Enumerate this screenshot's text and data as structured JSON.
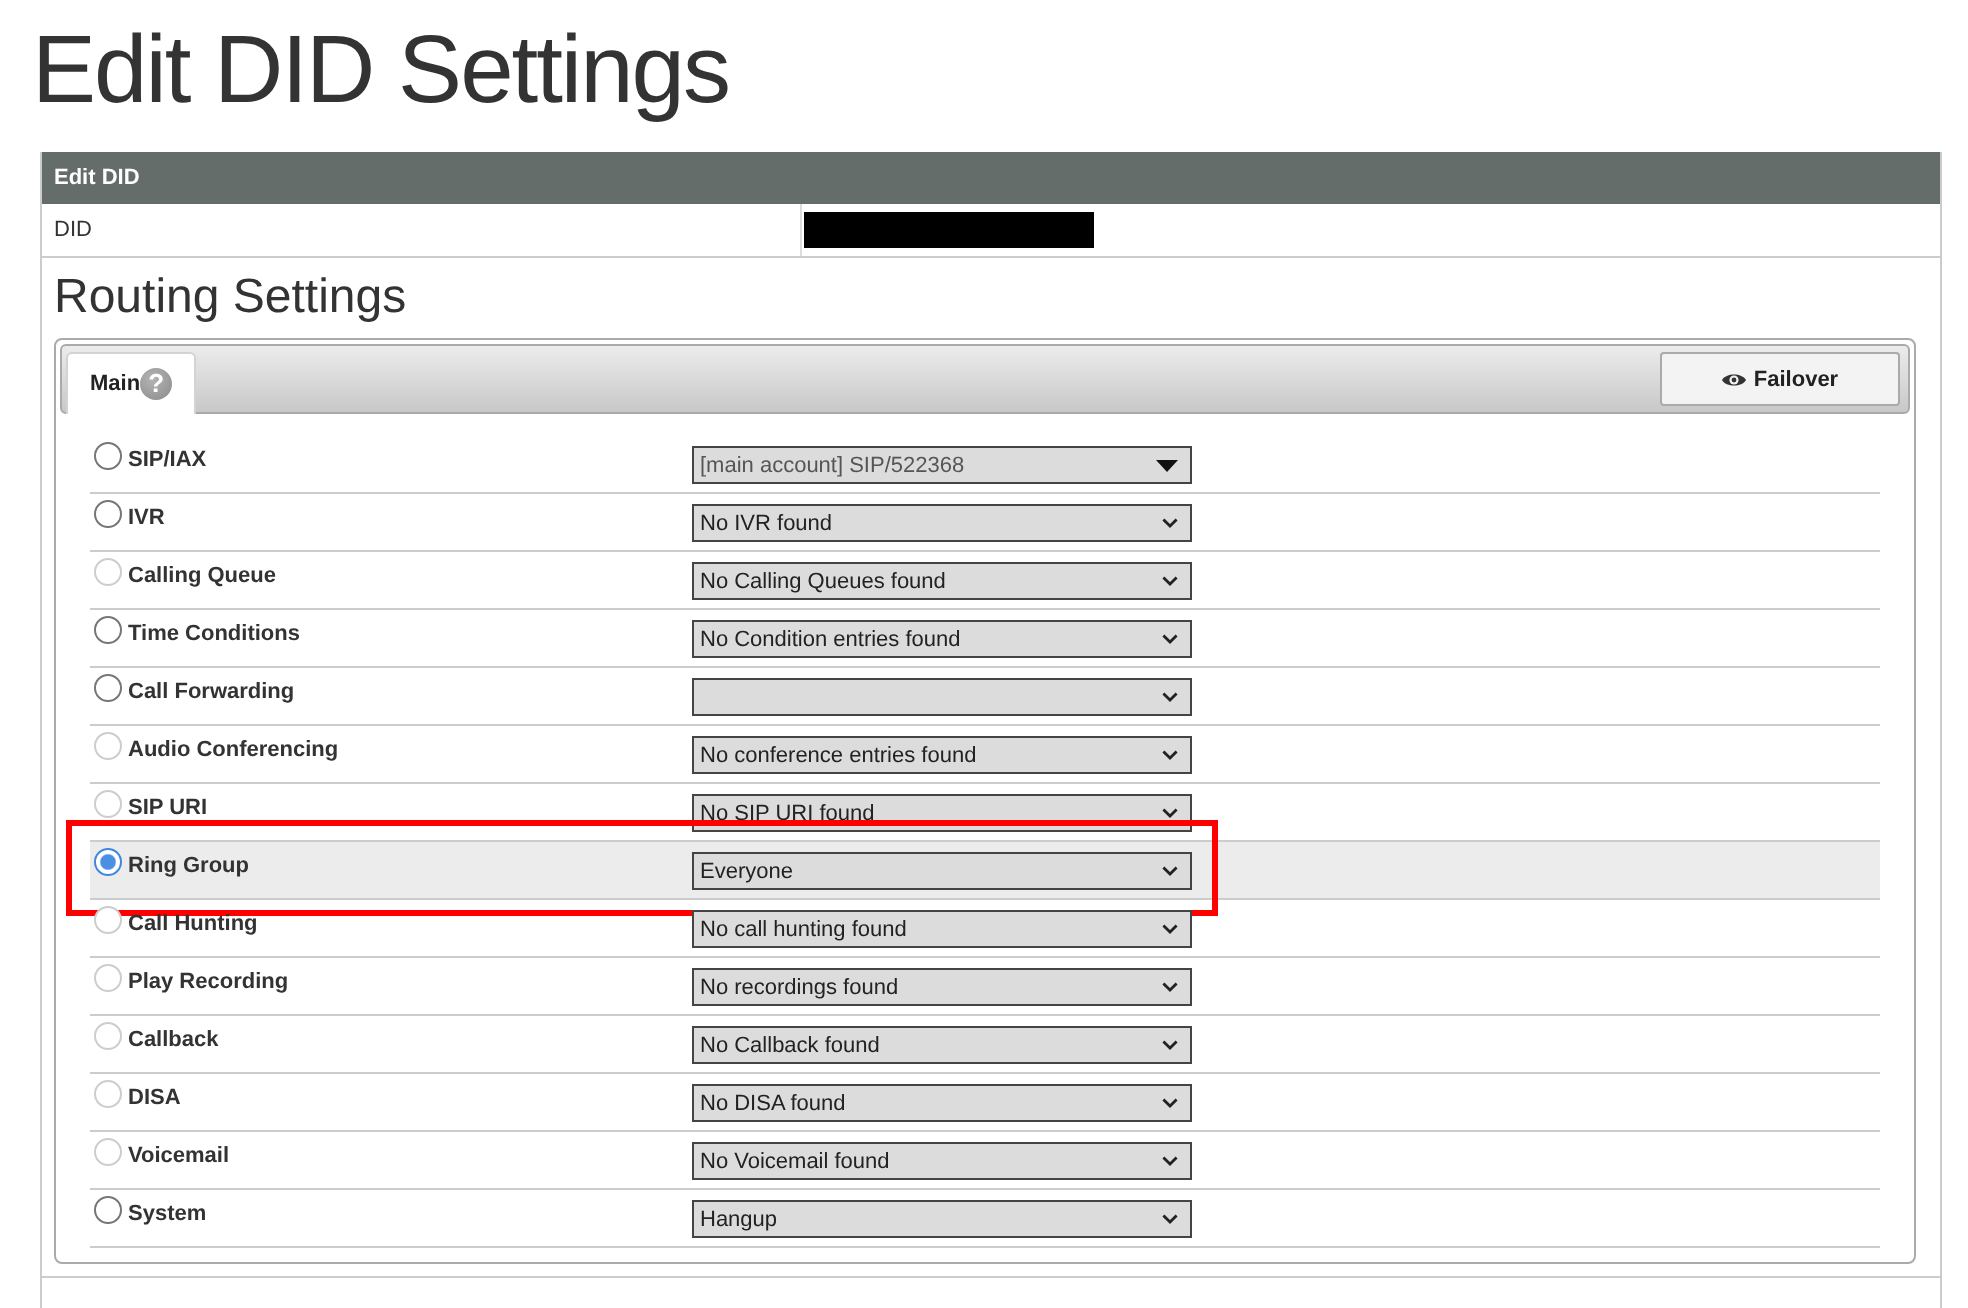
{
  "page_title": "Edit DID Settings",
  "panel": {
    "title": "Edit DID",
    "did_label": "DID"
  },
  "routing": {
    "heading": "Routing Settings",
    "tabs": [
      {
        "label": "Main",
        "help": "?",
        "selected": true
      }
    ],
    "failover_button": {
      "label": "Failover"
    },
    "routes": [
      {
        "label": "SIP/IAX",
        "selected": false,
        "disabled": false,
        "highlighted": false,
        "select": {
          "kind": "styled",
          "value": "[main account] SIP/522368"
        }
      },
      {
        "label": "IVR",
        "selected": false,
        "disabled": false,
        "highlighted": false,
        "select": {
          "kind": "native",
          "value": "No IVR found"
        }
      },
      {
        "label": "Calling Queue",
        "selected": false,
        "disabled": true,
        "highlighted": false,
        "select": {
          "kind": "native",
          "value": "No Calling Queues found"
        }
      },
      {
        "label": "Time Conditions",
        "selected": false,
        "disabled": false,
        "highlighted": false,
        "select": {
          "kind": "native",
          "value": "No Condition entries found"
        }
      },
      {
        "label": "Call Forwarding",
        "selected": false,
        "disabled": false,
        "highlighted": false,
        "select": {
          "kind": "native"
        }
      },
      {
        "label": "Audio Conferencing",
        "selected": false,
        "disabled": true,
        "highlighted": false,
        "select": {
          "kind": "native",
          "value": "No conference entries found"
        }
      },
      {
        "label": "SIP URI",
        "selected": false,
        "disabled": true,
        "highlighted": false,
        "select": {
          "kind": "native",
          "value": "No SIP URI found"
        }
      },
      {
        "label": "Ring Group",
        "selected": true,
        "disabled": false,
        "highlighted": true,
        "select": {
          "kind": "native",
          "value": "Everyone"
        }
      },
      {
        "label": "Call Hunting",
        "selected": false,
        "disabled": true,
        "highlighted": false,
        "select": {
          "kind": "native",
          "value": "No call hunting found"
        }
      },
      {
        "label": "Play Recording",
        "selected": false,
        "disabled": true,
        "highlighted": false,
        "select": {
          "kind": "native",
          "value": "No recordings found"
        }
      },
      {
        "label": "Callback",
        "selected": false,
        "disabled": true,
        "highlighted": false,
        "select": {
          "kind": "native",
          "value": "No Callback found"
        }
      },
      {
        "label": "DISA",
        "selected": false,
        "disabled": true,
        "highlighted": false,
        "select": {
          "kind": "native",
          "value": "No DISA found"
        }
      },
      {
        "label": "Voicemail",
        "selected": false,
        "disabled": true,
        "highlighted": false,
        "select": {
          "kind": "native",
          "value": "No Voicemail found"
        }
      },
      {
        "label": "System",
        "selected": false,
        "disabled": false,
        "highlighted": false,
        "select": {
          "kind": "native",
          "value": "Hangup"
        }
      }
    ]
  }
}
